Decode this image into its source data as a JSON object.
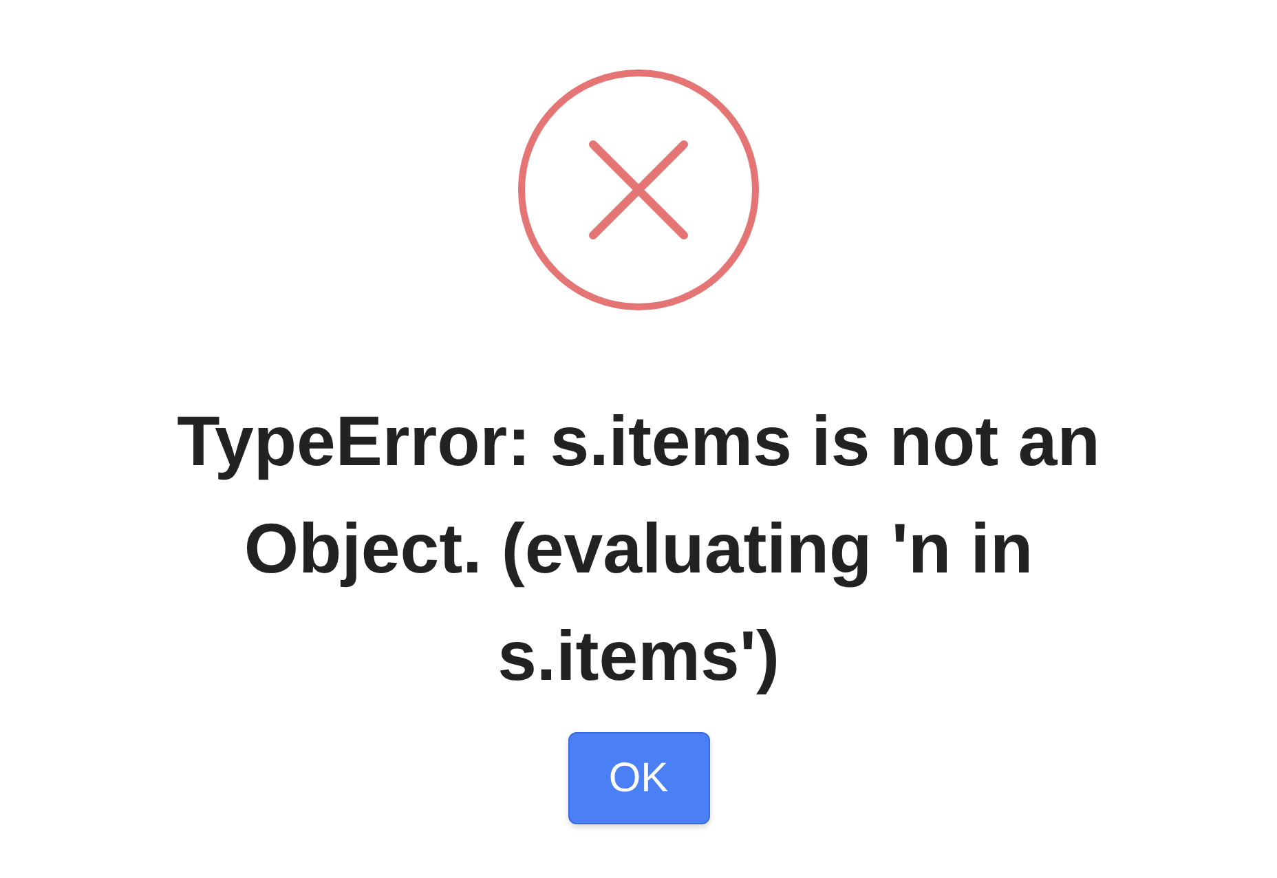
{
  "dialog": {
    "kind": "error",
    "message": "TypeError: s.items is not an Object. (evaluating 'n in s.items')",
    "buttons": [
      "OK"
    ]
  }
}
